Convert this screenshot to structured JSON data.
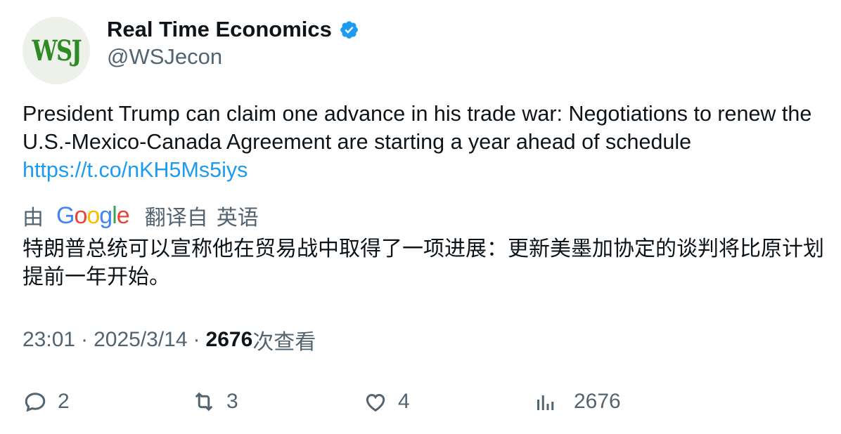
{
  "author": {
    "display_name": "Real Time Economics",
    "handle": "@WSJecon",
    "avatar_text": "WSJ",
    "verified": true
  },
  "tweet": {
    "text": "President Trump can claim one advance in his trade war: Negotiations to renew the U.S.-Mexico-Canada Agreement are starting a year ahead of schedule",
    "link": "https://t.co/nKH5Ms5iys"
  },
  "translation": {
    "by": "由",
    "provider": "Google",
    "translated_from": "翻译自",
    "language": "英语",
    "text": "特朗普总统可以宣称他在贸易战中取得了一项进展：更新美墨加协定的谈判将比原计划提前一年开始。"
  },
  "meta": {
    "time": "23:01",
    "separator": "·",
    "date": "2025/3/14",
    "views_count": "2676",
    "views_label": "次查看"
  },
  "actions": {
    "replies": "2",
    "retweets": "3",
    "likes": "4",
    "views": "2676"
  },
  "colors": {
    "accent": "#1d9bf0",
    "secondary_text": "#536471",
    "primary_text": "#0f1419",
    "wsj_green": "#2e8a24"
  },
  "icons": [
    "verified-badge-icon",
    "reply-icon",
    "retweet-icon",
    "like-icon",
    "views-icon",
    "google-logo"
  ]
}
